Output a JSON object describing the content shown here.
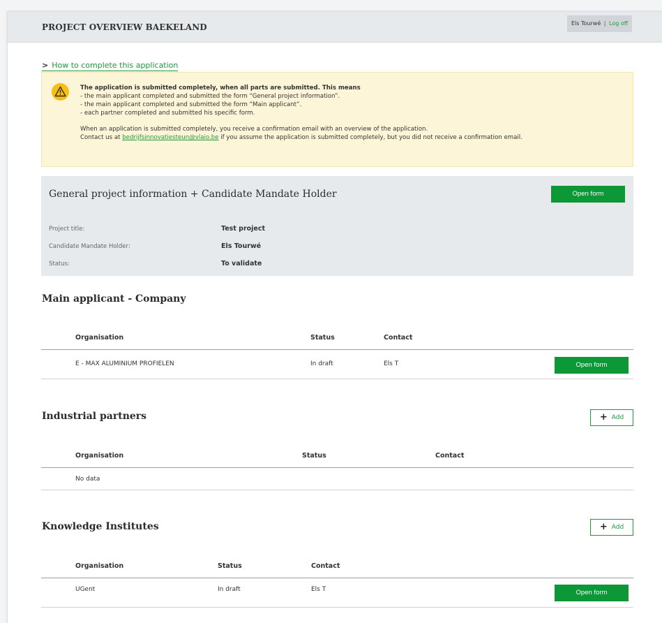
{
  "header": {
    "title": "PROJECT OVERVIEW BAEKELAND",
    "user_name": "Els Tourwé",
    "separator": "|",
    "logoff_label": "Log off"
  },
  "howto": {
    "chevron": ">",
    "label": "How to complete this application"
  },
  "warning": {
    "icon": "warning-triangle-icon",
    "heading": "The application is submitted completely, when all parts are submitted. This means",
    "lines": [
      "- the main applicant completed and submitted the form “General project information”.",
      "- the main applicant completed and submitted the form “Main applicant”.",
      "- each partner completed and submitted his specific form."
    ],
    "confirm_text": "When an application is submitted completely, you receive a confirmation email with an overview of the application.",
    "contact_prefix": "Contact us at",
    "contact_email": "bedrijfsinnovatiesteun@vlaio.be",
    "contact_suffix": "if you assume the application is submitted completely, but you did not receive a confirmation email."
  },
  "general": {
    "title": "General project information + Candidate Mandate Holder",
    "open_label": "Open form",
    "fields": [
      {
        "label": "Project title:",
        "value": "Test project"
      },
      {
        "label": "Candidate Mandate Holder:",
        "value": "Els Tourwé"
      },
      {
        "label": "Status:",
        "value": "To validate"
      }
    ]
  },
  "main_applicant": {
    "title": "Main applicant - Company",
    "columns": [
      "Organisation",
      "Status",
      "Contact"
    ],
    "rows": [
      {
        "organisation": "E - MAX ALUMINIUM PROFIELEN",
        "status": "In draft",
        "contact": "Els T",
        "action": "Open form"
      }
    ]
  },
  "industrial": {
    "title": "Industrial partners",
    "add_label": "Add",
    "columns": [
      "Organisation",
      "Status",
      "Contact"
    ],
    "empty": "No data"
  },
  "knowledge": {
    "title": "Knowledge Institutes",
    "add_label": "Add",
    "columns": [
      "Organisation",
      "Status",
      "Contact"
    ],
    "rows": [
      {
        "organisation": "UGent",
        "status": "In draft",
        "contact": "Els T",
        "action": "Open form"
      }
    ]
  },
  "colors": {
    "accent_green": "#0d9837",
    "link_green": "#1e9a3b",
    "warning_bg": "#fdf5d8",
    "warning_icon": "#f5bf1a",
    "panel_gray": "#e7eaed"
  }
}
